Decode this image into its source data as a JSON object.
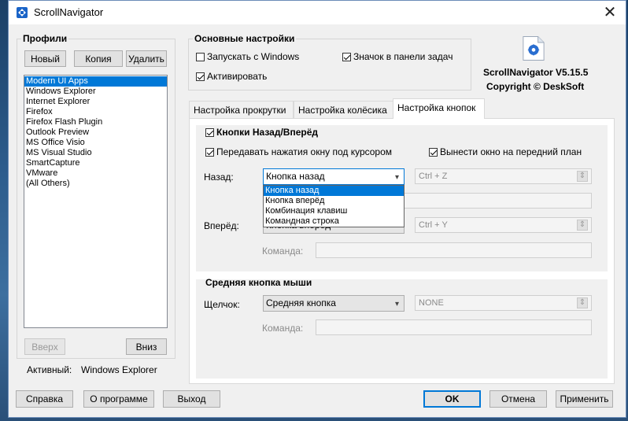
{
  "window": {
    "title": "ScrollNavigator",
    "close_glyph": "✕"
  },
  "profiles": {
    "heading": "Профили",
    "buttons": {
      "new": "Новый",
      "copy": "Копия",
      "delete": "Удалить"
    },
    "items": [
      "Modern UI Apps",
      "Windows Explorer",
      "Internet Explorer",
      "Firefox",
      "Firefox Flash Plugin",
      "Outlook Preview",
      "MS Office Visio",
      "MS Visual Studio",
      "SmartCapture",
      "VMware",
      "(All Others)"
    ],
    "selected_index": 0,
    "up": "Вверх",
    "down": "Вниз",
    "active_label": "Активный:",
    "active_value": "Windows Explorer"
  },
  "main_settings": {
    "heading": "Основные настройки",
    "start_with_windows": {
      "label": "Запускать с Windows",
      "checked": false
    },
    "tray_icon": {
      "label": "Значок в панели задач",
      "checked": true
    },
    "activate": {
      "label": "Активировать",
      "checked": true
    }
  },
  "about": {
    "version": "ScrollNavigator V5.15.5",
    "copyright": "Copyright © DeskSoft",
    "logo_icon": "navigator-logo-icon"
  },
  "tabs": [
    "Настройка прокрутки",
    "Настройка колёсика",
    "Настройка кнопок"
  ],
  "active_tab": 2,
  "buttons_tab": {
    "back_forward_group": {
      "label": "Кнопки Назад/Вперёд",
      "checked": true
    },
    "pass_clicks": {
      "label": "Передавать нажатия окну под курсором",
      "checked": true
    },
    "bring_front": {
      "label": "Вынести окно на передний план",
      "checked": true
    },
    "back": {
      "label": "Назад:",
      "value": "Кнопка назад",
      "shortcut": "Ctrl + Z"
    },
    "forward": {
      "label": "Вперёд:",
      "value": "Кнопка вперёд",
      "shortcut": "Ctrl + Y",
      "command_label": "Команда:"
    },
    "dropdown_options": [
      "Кнопка назад",
      "Кнопка вперёд",
      "Комбинация клавиш",
      "Командная строка"
    ],
    "dropdown_selected": 0,
    "middle": {
      "heading": "Средняя кнопка мыши",
      "click_label": "Щелчок:",
      "click_value": "Средняя кнопка",
      "shortcut": "NONE",
      "command_label": "Команда:"
    },
    "arrow_glyph": "▾",
    "stepper_glyph": "⇕"
  },
  "footer": {
    "help": "Справка",
    "about": "О программе",
    "exit": "Выход",
    "ok": "OK",
    "cancel": "Отмена",
    "apply": "Применить"
  }
}
